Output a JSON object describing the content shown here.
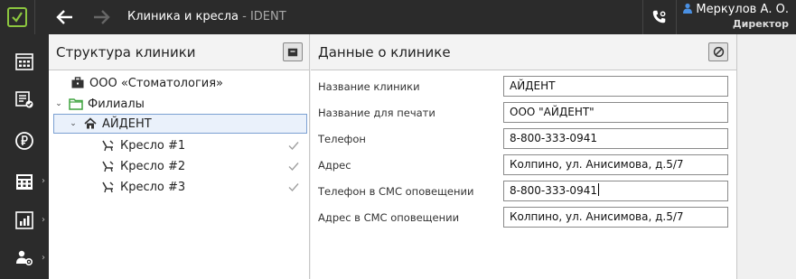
{
  "window": {
    "title": "Клиника и кресла",
    "title_sub": " - IDENT"
  },
  "user": {
    "name": "Меркулов А. О.",
    "role": "Директор"
  },
  "icons": {
    "logo": "checkbox-logo-icon",
    "back": "arrow-left-icon",
    "forward": "arrow-right-icon",
    "phone": "phone-settings-icon",
    "user": "user-icon"
  },
  "sidebar": {
    "items": [
      {
        "icon": "schedule-grid-icon"
      },
      {
        "icon": "documents-check-icon"
      },
      {
        "icon": "ruble-icon"
      },
      {
        "icon": "calendar-calculator-icon"
      },
      {
        "icon": "reports-chart-icon"
      },
      {
        "icon": "users-settings-icon"
      }
    ]
  },
  "left_panel": {
    "title": "Структура клиники",
    "tree": {
      "org": "ООО «Стоматология»",
      "branches": "Филиалы",
      "clinic": "АЙДЕНТ",
      "chairs": [
        "Кресло #1",
        "Кресло #2",
        "Кресло #3"
      ]
    }
  },
  "right_panel": {
    "title": "Данные о клинике",
    "fields": [
      {
        "label": "Название клиники",
        "value": "АЙДЕНТ"
      },
      {
        "label": "Название для печати",
        "value": "ООО \"АЙДЕНТ\""
      },
      {
        "label": "Телефон",
        "value": "8-800-333-0941"
      },
      {
        "label": "Адрес",
        "value": "Колпино, ул. Анисимова, д.5/7"
      },
      {
        "label": "Телефон в СМС оповещении",
        "value": "8-800-333-0941"
      },
      {
        "label": "Адрес в СМС оповещении",
        "value": "Колпино, ул. Анисимова, д.5/7"
      }
    ]
  },
  "colors": {
    "topbar": "#2b2b2b",
    "logo_accent": "#8cc63f",
    "selection_border": "#7ba0d2",
    "user_icon": "#4a90e2",
    "folder": "#3fa33f"
  }
}
